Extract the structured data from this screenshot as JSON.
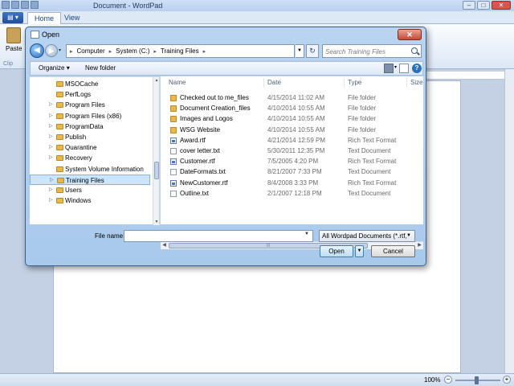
{
  "wordpad": {
    "title": "Document - WordPad",
    "app_button": "▤ ▾",
    "tabs": [
      "Home",
      "View"
    ],
    "paste_label": "Paste",
    "clipboard_label": "Clip",
    "zoom": "100%",
    "window_controls": [
      "–",
      "□",
      "✕"
    ]
  },
  "dialog": {
    "title": "Open",
    "close": "✕",
    "breadcrumb": [
      "Computer",
      "System (C:)",
      "Training Files"
    ],
    "search_placeholder": "Search Training Files",
    "toolbar": {
      "organize": "Organize",
      "new_folder": "New folder",
      "help": "?"
    },
    "nav_tree": [
      {
        "label": "MSOCache",
        "arrow": ""
      },
      {
        "label": "PerfLogs",
        "arrow": ""
      },
      {
        "label": "Program Files",
        "arrow": "▷"
      },
      {
        "label": "Program Files (x86)",
        "arrow": "▷"
      },
      {
        "label": "ProgramData",
        "arrow": "▷"
      },
      {
        "label": "Publish",
        "arrow": "▷"
      },
      {
        "label": "Quarantine",
        "arrow": "▷"
      },
      {
        "label": "Recovery",
        "arrow": "▷"
      },
      {
        "label": "System Volume Information",
        "arrow": ""
      },
      {
        "label": "Training Files",
        "arrow": "▷",
        "selected": true
      },
      {
        "label": "Users",
        "arrow": "▷"
      },
      {
        "label": "Windows",
        "arrow": "▷"
      }
    ],
    "columns": {
      "name": "Name",
      "date": "Date",
      "type": "Type",
      "size": "Size"
    },
    "files": [
      {
        "name": "Checked out to me_files",
        "date": "4/15/2014 11:02 AM",
        "type": "File folder",
        "icon": "folder"
      },
      {
        "name": "Document Creation_files",
        "date": "4/10/2014 10:55 AM",
        "type": "File folder",
        "icon": "folder"
      },
      {
        "name": "Images and Logos",
        "date": "4/10/2014 10:55 AM",
        "type": "File folder",
        "icon": "folder"
      },
      {
        "name": "WSG Website",
        "date": "4/10/2014 10:55 AM",
        "type": "File folder",
        "icon": "folder"
      },
      {
        "name": "Award.rtf",
        "date": "4/21/2014 12:59 PM",
        "type": "Rich Text Format",
        "icon": "rtf"
      },
      {
        "name": "cover letter.txt",
        "date": "5/30/2011 12:35 PM",
        "type": "Text Document",
        "icon": "txt"
      },
      {
        "name": "Customer.rtf",
        "date": "7/5/2005 4:20 PM",
        "type": "Rich Text Format",
        "icon": "rtf"
      },
      {
        "name": "DateFormats.txt",
        "date": "8/21/2007 7:33 PM",
        "type": "Text Document",
        "icon": "txt"
      },
      {
        "name": "NewCustomer.rtf",
        "date": "8/4/2008 3:33 PM",
        "type": "Rich Text Format",
        "icon": "rtf"
      },
      {
        "name": "Outline.txt",
        "date": "2/1/2007 12:18 PM",
        "type": "Text Document",
        "icon": "txt"
      }
    ],
    "file_name_label": "File name:",
    "file_name_value": "",
    "filter": "All Wordpad Documents (*.rtf,",
    "open_label": "Open",
    "cancel_label": "Cancel"
  }
}
